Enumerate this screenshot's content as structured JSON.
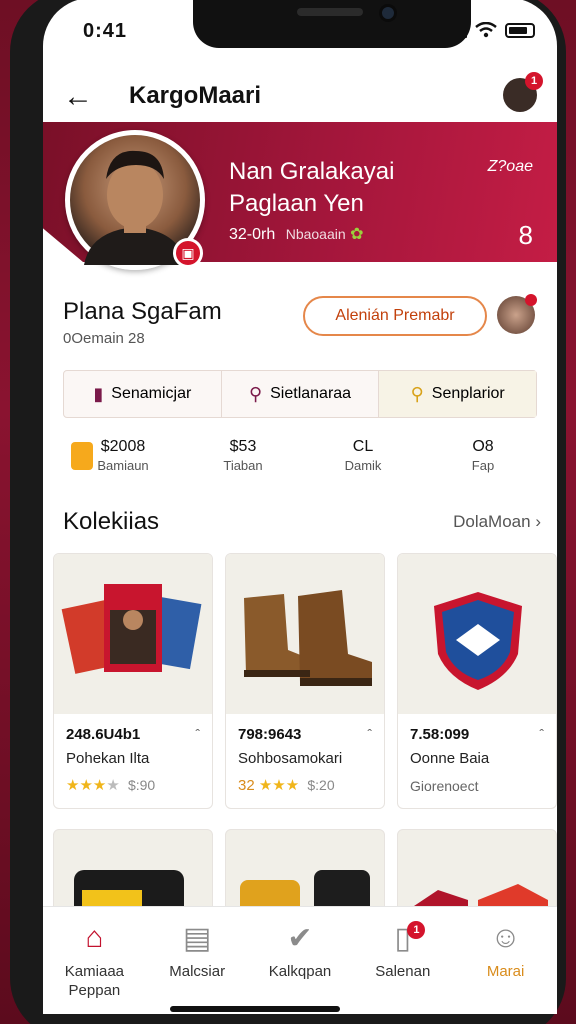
{
  "status": {
    "time": "0:41"
  },
  "appbar": {
    "title": "KargoMaari",
    "notif_count": "1"
  },
  "banner": {
    "title": "Nan Gralakayai Paglaan Yen",
    "sub": "32-0rh",
    "sub_muted": "Nbaoaain",
    "top_right": "Z?oae",
    "bottom_right": "8"
  },
  "profile": {
    "name": "Plana SgaFam",
    "meta": "0Oemain 28",
    "action_label": "Alenián Premabr"
  },
  "segments": [
    {
      "label": "Senamicjar",
      "icon": "bookmark-icon",
      "color": "#7a1a4a"
    },
    {
      "label": "Sietlanaraa",
      "icon": "search-icon",
      "color": "#7a1a4a"
    },
    {
      "label": "Senplarior",
      "icon": "key-icon",
      "color": "#d8a21a"
    }
  ],
  "stats": [
    {
      "value": "$2008",
      "label": "Bamiaun"
    },
    {
      "value": "$53",
      "label": "Tiaban"
    },
    {
      "value": "CL",
      "label": "Damik"
    },
    {
      "value": "O8",
      "label": "Fap"
    }
  ],
  "section": {
    "title": "Kolekiias",
    "link": "DolaMoan"
  },
  "products": [
    {
      "price": "248.6U4b1",
      "name": "Pohekan Ilta",
      "rating_prefix": "",
      "rating_text": "$:90",
      "stars": 3
    },
    {
      "price": "798:9643",
      "name": "Sohbosamokari",
      "rating_prefix": "32",
      "rating_text": "$:20",
      "stars": 3
    },
    {
      "price": "7.58:099",
      "name": "Oonne Baia",
      "extra": "Giorenoect"
    }
  ],
  "tabs": [
    {
      "label": "Kamiaaa",
      "label2": "Peppan",
      "icon": "home-icon"
    },
    {
      "label": "Malcsiar",
      "icon": "chat-icon"
    },
    {
      "label": "Kalkqpan",
      "icon": "check-badge-icon"
    },
    {
      "label": "Salenan",
      "icon": "bookmark-icon",
      "badge": "1"
    },
    {
      "label": "Marai",
      "icon": "user-icon"
    }
  ],
  "colors": {
    "brand": "#a3163b",
    "accent": "#e5874a",
    "star": "#f0b51a"
  }
}
